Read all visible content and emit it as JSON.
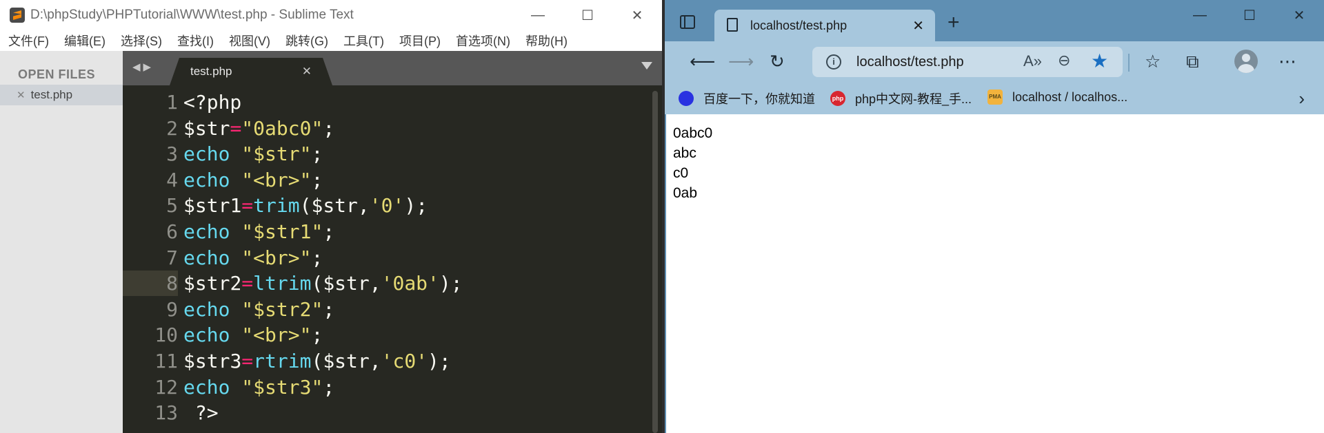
{
  "sublime": {
    "title": "D:\\phpStudy\\PHPTutorial\\WWW\\test.php - Sublime Text",
    "menu": [
      "文件(F)",
      "编辑(E)",
      "选择(S)",
      "查找(I)",
      "视图(V)",
      "跳转(G)",
      "工具(T)",
      "项目(P)",
      "首选项(N)",
      "帮助(H)"
    ],
    "sidebar_heading": "OPEN FILES",
    "open_file": "test.php",
    "tab_name": "test.php",
    "line_numbers": [
      "1",
      "2",
      "3",
      "4",
      "5",
      "6",
      "7",
      "8",
      "9",
      "10",
      "11",
      "12",
      "13"
    ],
    "highlighted_line": 8,
    "code_lines": [
      "<?php",
      "$str=\"0abc0\";",
      "echo \"$str\";",
      "echo \"<br>\";",
      "$str1=trim($str,'0');",
      "echo \"$str1\";",
      "echo \"<br>\";",
      "$str2=ltrim($str,'0ab');",
      "echo \"$str2\";",
      "echo \"<br>\";",
      "$str3=rtrim($str,'c0');",
      "echo \"$str3\";",
      " ?>"
    ],
    "colors": {
      "background": "#272822",
      "keyword": "#66d9ef",
      "string": "#e6db74",
      "operator": "#f92672"
    }
  },
  "edge": {
    "tab_title": "localhost/test.php",
    "address_url": "localhost/test.php",
    "favorites": [
      {
        "label": "百度一下，你就知道",
        "icon": "baidu-icon"
      },
      {
        "label": "php中文网-教程_手...",
        "icon": "php-icon"
      },
      {
        "label": "localhost / localhos...",
        "icon": "phpmyadmin-icon"
      }
    ],
    "output_lines": [
      "0abc0",
      "abc",
      "c0",
      "0ab"
    ],
    "colors": {
      "tab_strip": "#5f8fb3",
      "toolbar": "#a7c7dd",
      "favorite_star": "#1a6fc2"
    }
  }
}
